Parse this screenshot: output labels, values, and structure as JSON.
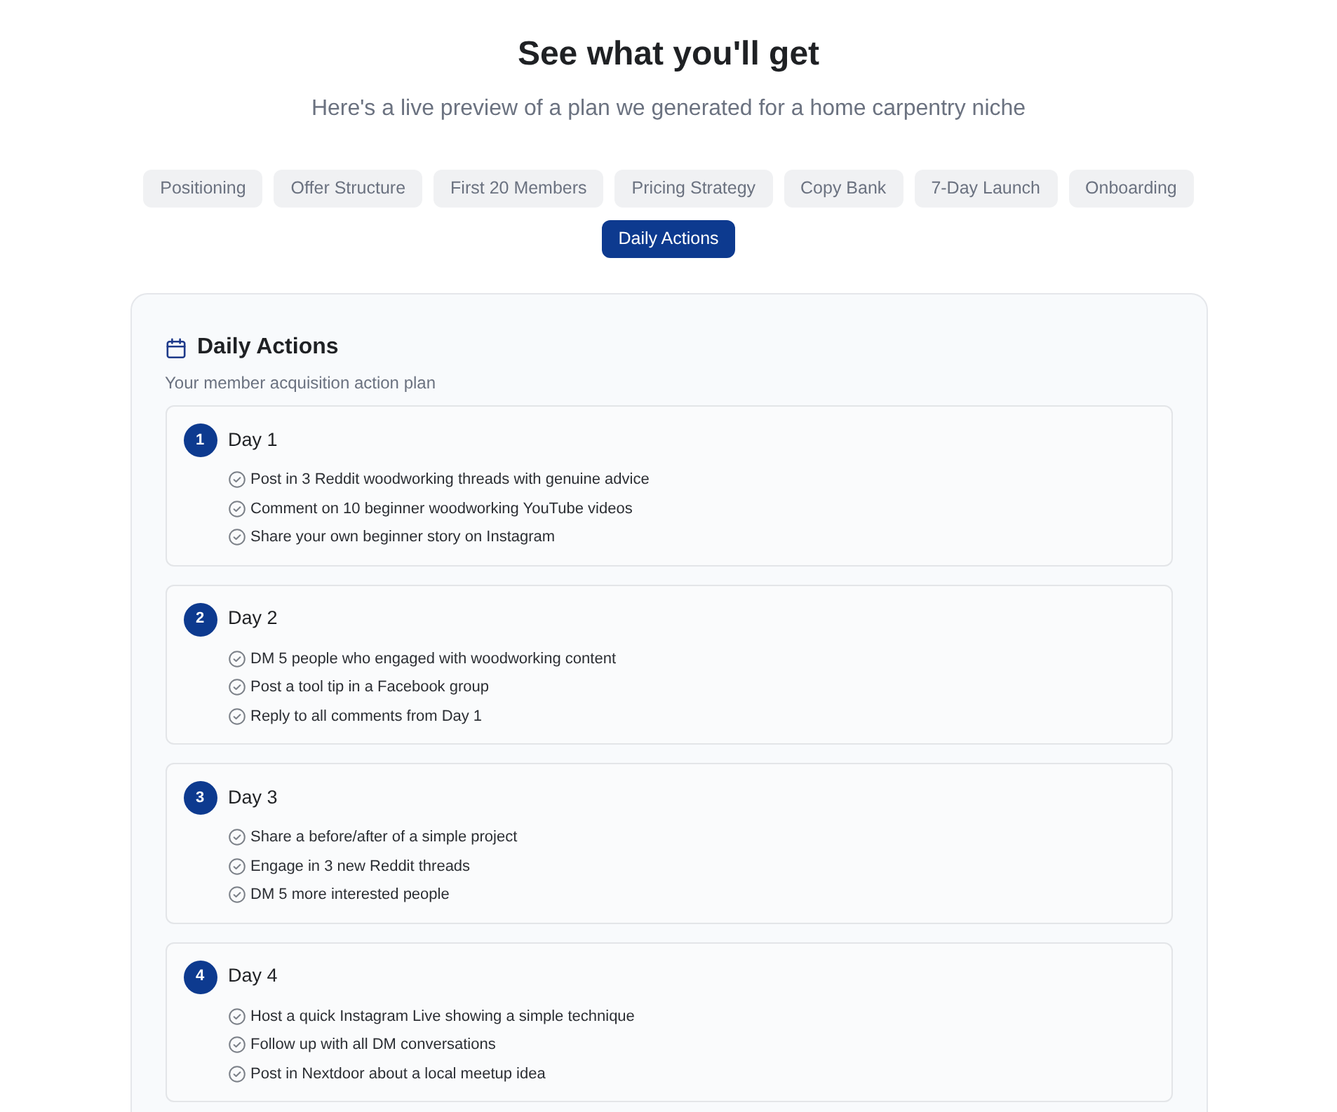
{
  "header": {
    "title": "See what you'll get",
    "subtitle": "Here's a live preview of a plan we generated for a home carpentry niche"
  },
  "tabs": [
    {
      "label": "Positioning",
      "selected": false
    },
    {
      "label": "Offer Structure",
      "selected": false
    },
    {
      "label": "First 20 Members",
      "selected": false
    },
    {
      "label": "Pricing Strategy",
      "selected": false
    },
    {
      "label": "Copy Bank",
      "selected": false
    },
    {
      "label": "7-Day Launch",
      "selected": false
    },
    {
      "label": "Onboarding",
      "selected": false
    },
    {
      "label": "Daily Actions",
      "selected": true
    }
  ],
  "panel": {
    "title": "Daily Actions",
    "subtitle": "Your member acquisition action plan",
    "days": [
      {
        "number": "1",
        "title": "Day 1",
        "actions": [
          "Post in 3 Reddit woodworking threads with genuine advice",
          "Comment on 10 beginner woodworking YouTube videos",
          "Share your own beginner story on Instagram"
        ]
      },
      {
        "number": "2",
        "title": "Day 2",
        "actions": [
          "DM 5 people who engaged with woodworking content",
          "Post a tool tip in a Facebook group",
          "Reply to all comments from Day 1"
        ]
      },
      {
        "number": "3",
        "title": "Day 3",
        "actions": [
          "Share a before/after of a simple project",
          "Engage in 3 new Reddit threads",
          "DM 5 more interested people"
        ]
      },
      {
        "number": "4",
        "title": "Day 4",
        "actions": [
          "Host a quick Instagram Live showing a simple technique",
          "Follow up with all DM conversations",
          "Post in Nextdoor about a local meetup idea"
        ]
      }
    ]
  }
}
